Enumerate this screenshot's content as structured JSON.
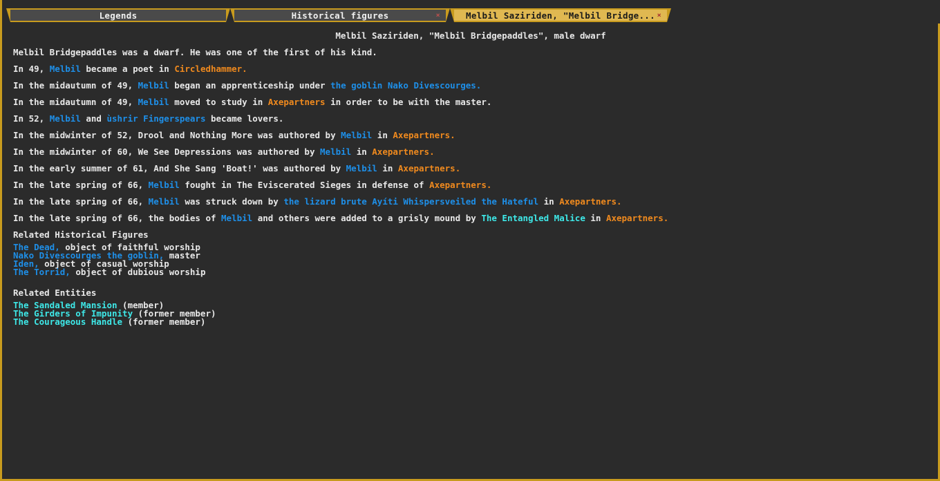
{
  "tabs": [
    {
      "label": "Legends",
      "closable": false,
      "active": false
    },
    {
      "label": "Historical figures",
      "closable": true,
      "active": false
    },
    {
      "label": "Melbil Saziriden, \"Melbil Bridge...",
      "closable": true,
      "active": true
    }
  ],
  "close_glyph": "×",
  "heading": "Melbil Saziriden, \"Melbil Bridgepaddles\", male dwarf",
  "events": [
    [
      {
        "t": "Melbil Bridgepaddles was a dwarf. He was one of the first of his kind.",
        "c": "white"
      }
    ],
    [
      {
        "t": "In 49, ",
        "c": "white"
      },
      {
        "t": "Melbil",
        "c": "blue"
      },
      {
        "t": " became a poet in ",
        "c": "white"
      },
      {
        "t": "Circledhammer.",
        "c": "orange"
      }
    ],
    [
      {
        "t": "In the midautumn of 49, ",
        "c": "white"
      },
      {
        "t": "Melbil",
        "c": "blue"
      },
      {
        "t": " began an apprenticeship under ",
        "c": "white"
      },
      {
        "t": "the goblin Nako Divescourges.",
        "c": "blue"
      }
    ],
    [
      {
        "t": "In the midautumn of 49, ",
        "c": "white"
      },
      {
        "t": "Melbil",
        "c": "blue"
      },
      {
        "t": " moved to study in ",
        "c": "white"
      },
      {
        "t": "Axepartners",
        "c": "orange"
      },
      {
        "t": " in order to be with the master.",
        "c": "white"
      }
    ],
    [
      {
        "t": "In 52, ",
        "c": "white"
      },
      {
        "t": "Melbil",
        "c": "blue"
      },
      {
        "t": " and ",
        "c": "white"
      },
      {
        "t": "ùshrir Fingerspears",
        "c": "blue"
      },
      {
        "t": " became lovers.",
        "c": "white"
      }
    ],
    [
      {
        "t": "In the midwinter of 52, Drool and Nothing More was authored by ",
        "c": "white"
      },
      {
        "t": "Melbil",
        "c": "blue"
      },
      {
        "t": " in ",
        "c": "white"
      },
      {
        "t": "Axepartners.",
        "c": "orange"
      }
    ],
    [
      {
        "t": "In the midwinter of 60, We See Depressions was authored by ",
        "c": "white"
      },
      {
        "t": "Melbil",
        "c": "blue"
      },
      {
        "t": " in ",
        "c": "white"
      },
      {
        "t": "Axepartners.",
        "c": "orange"
      }
    ],
    [
      {
        "t": "In the early summer of 61, And She Sang 'Boat!' was authored by ",
        "c": "white"
      },
      {
        "t": "Melbil",
        "c": "blue"
      },
      {
        "t": " in ",
        "c": "white"
      },
      {
        "t": "Axepartners.",
        "c": "orange"
      }
    ],
    [
      {
        "t": "In the late spring of 66, ",
        "c": "white"
      },
      {
        "t": "Melbil",
        "c": "blue"
      },
      {
        "t": " fought in The Eviscerated Sieges in defense of ",
        "c": "white"
      },
      {
        "t": "Axepartners.",
        "c": "orange"
      }
    ],
    [
      {
        "t": "In the late spring of 66, ",
        "c": "white"
      },
      {
        "t": "Melbil",
        "c": "blue"
      },
      {
        "t": " was struck down by ",
        "c": "white"
      },
      {
        "t": "the lizard brute Ayíti Whispersveiled the Hateful",
        "c": "blue"
      },
      {
        "t": " in ",
        "c": "white"
      },
      {
        "t": "Axepartners.",
        "c": "orange"
      }
    ],
    [
      {
        "t": "In the late spring of 66, the bodies of ",
        "c": "white"
      },
      {
        "t": "Melbil",
        "c": "blue"
      },
      {
        "t": " and others were added to a grisly mound by ",
        "c": "white"
      },
      {
        "t": "The Entangled Malice",
        "c": "cyan"
      },
      {
        "t": " in ",
        "c": "white"
      },
      {
        "t": "Axepartners.",
        "c": "orange"
      }
    ]
  ],
  "related_figures_title": "Related Historical Figures",
  "related_figures": [
    [
      {
        "t": "The Dead,",
        "c": "blue"
      },
      {
        "t": " object of faithful worship",
        "c": "white"
      }
    ],
    [
      {
        "t": "Nako Divescourges the goblin,",
        "c": "blue"
      },
      {
        "t": " master",
        "c": "white"
      }
    ],
    [
      {
        "t": "Iden,",
        "c": "blue"
      },
      {
        "t": " object of casual worship",
        "c": "white"
      }
    ],
    [
      {
        "t": "The Torrid,",
        "c": "blue"
      },
      {
        "t": " object of dubious worship",
        "c": "white"
      }
    ]
  ],
  "related_entities_title": "Related Entities",
  "related_entities": [
    [
      {
        "t": "The Sandaled Mansion",
        "c": "cyan"
      },
      {
        "t": " (member)",
        "c": "white"
      }
    ],
    [
      {
        "t": "The Girders of Impunity",
        "c": "cyan"
      },
      {
        "t": " (former member)",
        "c": "white"
      }
    ],
    [
      {
        "t": "The Courageous Handle",
        "c": "cyan"
      },
      {
        "t": " (former member)",
        "c": "white"
      }
    ]
  ],
  "colors": {
    "frame": "#c89b1e",
    "background": "#2b2b2b",
    "figure_link": "#1e8fe8",
    "site_link": "#f08a1e",
    "entity_link": "#3ee8e8",
    "text": "#e8e8e8"
  }
}
